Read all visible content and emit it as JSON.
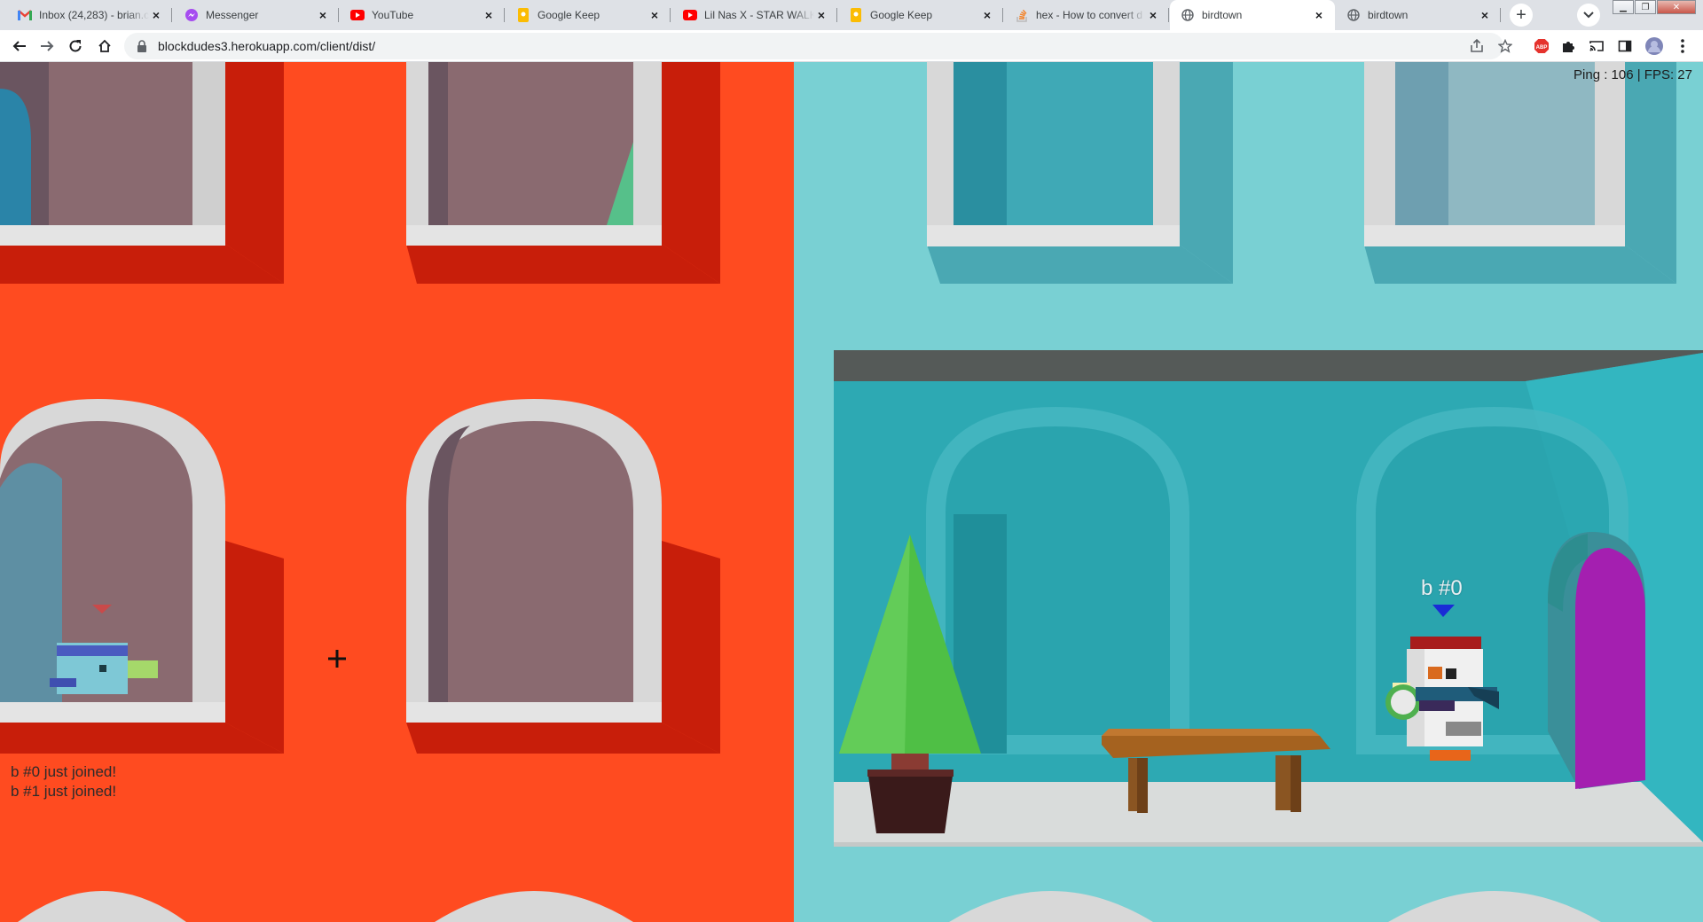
{
  "browser": {
    "tabs": [
      {
        "title": "Inbox (24,283) - brian.c",
        "icon": "gmail-icon",
        "active": false
      },
      {
        "title": "Messenger",
        "icon": "messenger-icon",
        "active": false
      },
      {
        "title": "YouTube",
        "icon": "youtube-icon",
        "active": false
      },
      {
        "title": "Google Keep",
        "icon": "keep-icon",
        "active": false
      },
      {
        "title": "Lil Nas X - STAR WALKI",
        "icon": "youtube-icon",
        "active": false
      },
      {
        "title": "Google Keep",
        "icon": "keep-icon",
        "active": false
      },
      {
        "title": "hex - How to convert d",
        "icon": "stackoverflow-icon",
        "active": false
      },
      {
        "title": "birdtown",
        "icon": "globe-icon",
        "active": true
      },
      {
        "title": "birdtown",
        "icon": "globe-icon",
        "active": false
      }
    ],
    "new_tab_label": "+",
    "url": "blockdudes3.herokuapp.com/client/dist/",
    "colors": {
      "tab_strip": "#dee1e6",
      "active_tab": "#ffffff"
    }
  },
  "game": {
    "hud": {
      "stats": "Ping : 106 | FPS: 27"
    },
    "chat": [
      "b #0 just joined!",
      "b #1 just joined!"
    ],
    "player_nametag": "b #0",
    "colors": {
      "left_wall": "#ff4b20",
      "right_wall": "#79d0d3",
      "window_frame": "#d8d8d8",
      "window_glass": "#8a6a70",
      "room_interior": "#2da9b3",
      "door": "#a41fb0",
      "tree": "#4fbf45",
      "pot": "#3a1a1a",
      "bench": "#a5621f"
    }
  }
}
